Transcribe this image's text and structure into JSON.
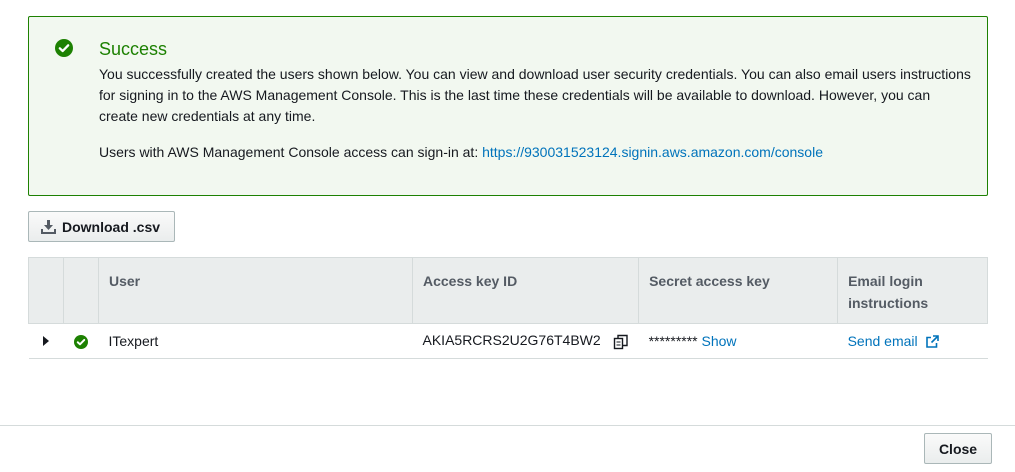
{
  "alert": {
    "title": "Success",
    "message": "You successfully created the users shown below. You can view and download user security credentials. You can also email users instructions for signing in to the AWS Management Console. This is the last time these credentials will be available to download. However, you can create new credentials at any time.",
    "signin_prefix": "Users with AWS Management Console access can sign-in at: ",
    "signin_url": "https://930031523124.signin.aws.amazon.com/console",
    "icon": "check-circle-icon",
    "color": "#1d8102"
  },
  "toolbar": {
    "download_label": "Download .csv",
    "download_icon": "download-icon"
  },
  "table": {
    "headers": {
      "user": "User",
      "access_key": "Access key ID",
      "secret_key": "Secret access key",
      "email": "Email login instructions"
    },
    "rows": [
      {
        "user": "ITexpert",
        "access_key": "AKIA5RCRS2U2G76T4BW2",
        "secret_mask": "*********",
        "show_label": "Show",
        "email_label": "Send email"
      }
    ]
  },
  "footer": {
    "close_label": "Close"
  },
  "colors": {
    "link": "#0073bb",
    "success": "#1d8102",
    "header_bg": "#eaeded"
  }
}
